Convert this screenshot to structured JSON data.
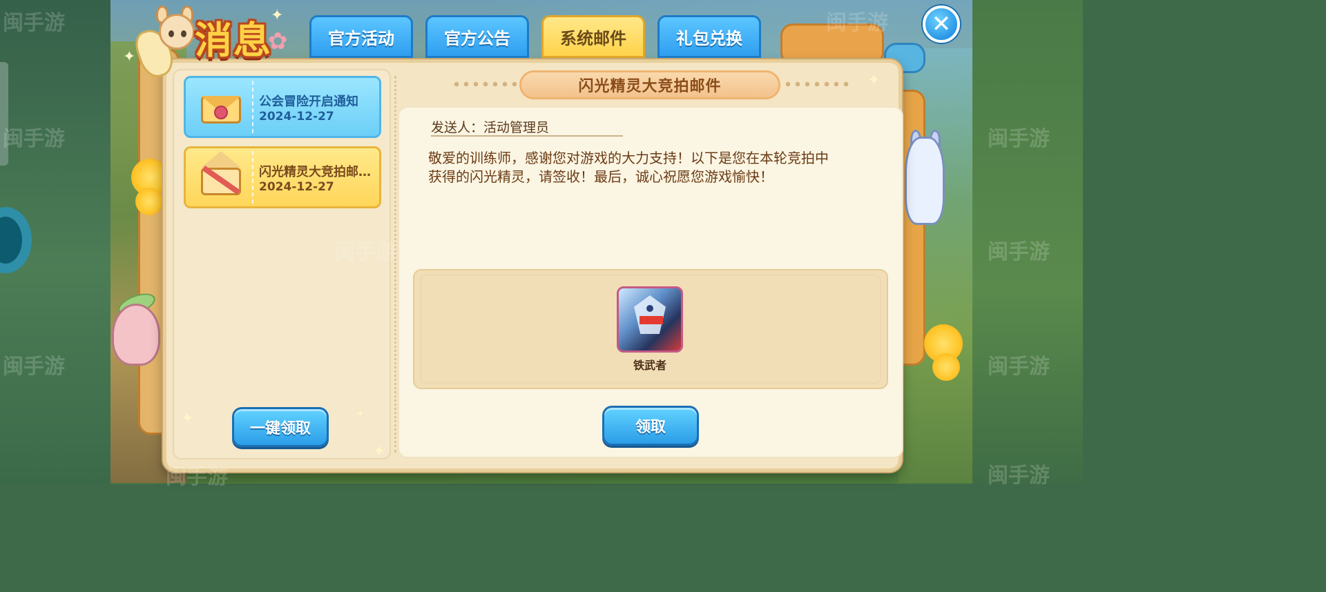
{
  "header": {
    "title": "消息",
    "tabs": [
      {
        "label": "官方活动",
        "active": false
      },
      {
        "label": "官方公告",
        "active": false
      },
      {
        "label": "系统邮件",
        "active": true
      },
      {
        "label": "礼包兑换",
        "active": false
      }
    ],
    "close_icon": "close-x-icon"
  },
  "mail_list": {
    "items": [
      {
        "title": "公会冒险开启通知",
        "date": "2024-12-27",
        "icon": "sealed-envelope-icon",
        "color": "#6ccff7"
      },
      {
        "title": "闪光精灵大竞拍邮…",
        "date": "2024-12-27",
        "icon": "open-envelope-icon",
        "color": "#ffd65a",
        "selected": true
      }
    ],
    "claim_all_label": "一键领取"
  },
  "mail_detail": {
    "title": "闪光精灵大竞拍邮件",
    "sender": "发送人：活动管理员",
    "body_line1": "敬爱的训练师，感谢您对游戏的大力支持！以下是您在本轮竞拍中",
    "body_line2": "获得的闪光精灵，请签收！最后，诚心祝愿您游戏愉快！",
    "attachment": {
      "name": "铁武者",
      "icon": "mecha-creature-icon"
    },
    "claim_label": "领取"
  },
  "watermark": "闽手游",
  "colors": {
    "accent_blue": "#2f9ef0",
    "active_tab": "#ffd34a",
    "title_text": "#8a4d1a",
    "body_text": "#6b3b14",
    "panel_bg": "#fbf5e3"
  }
}
